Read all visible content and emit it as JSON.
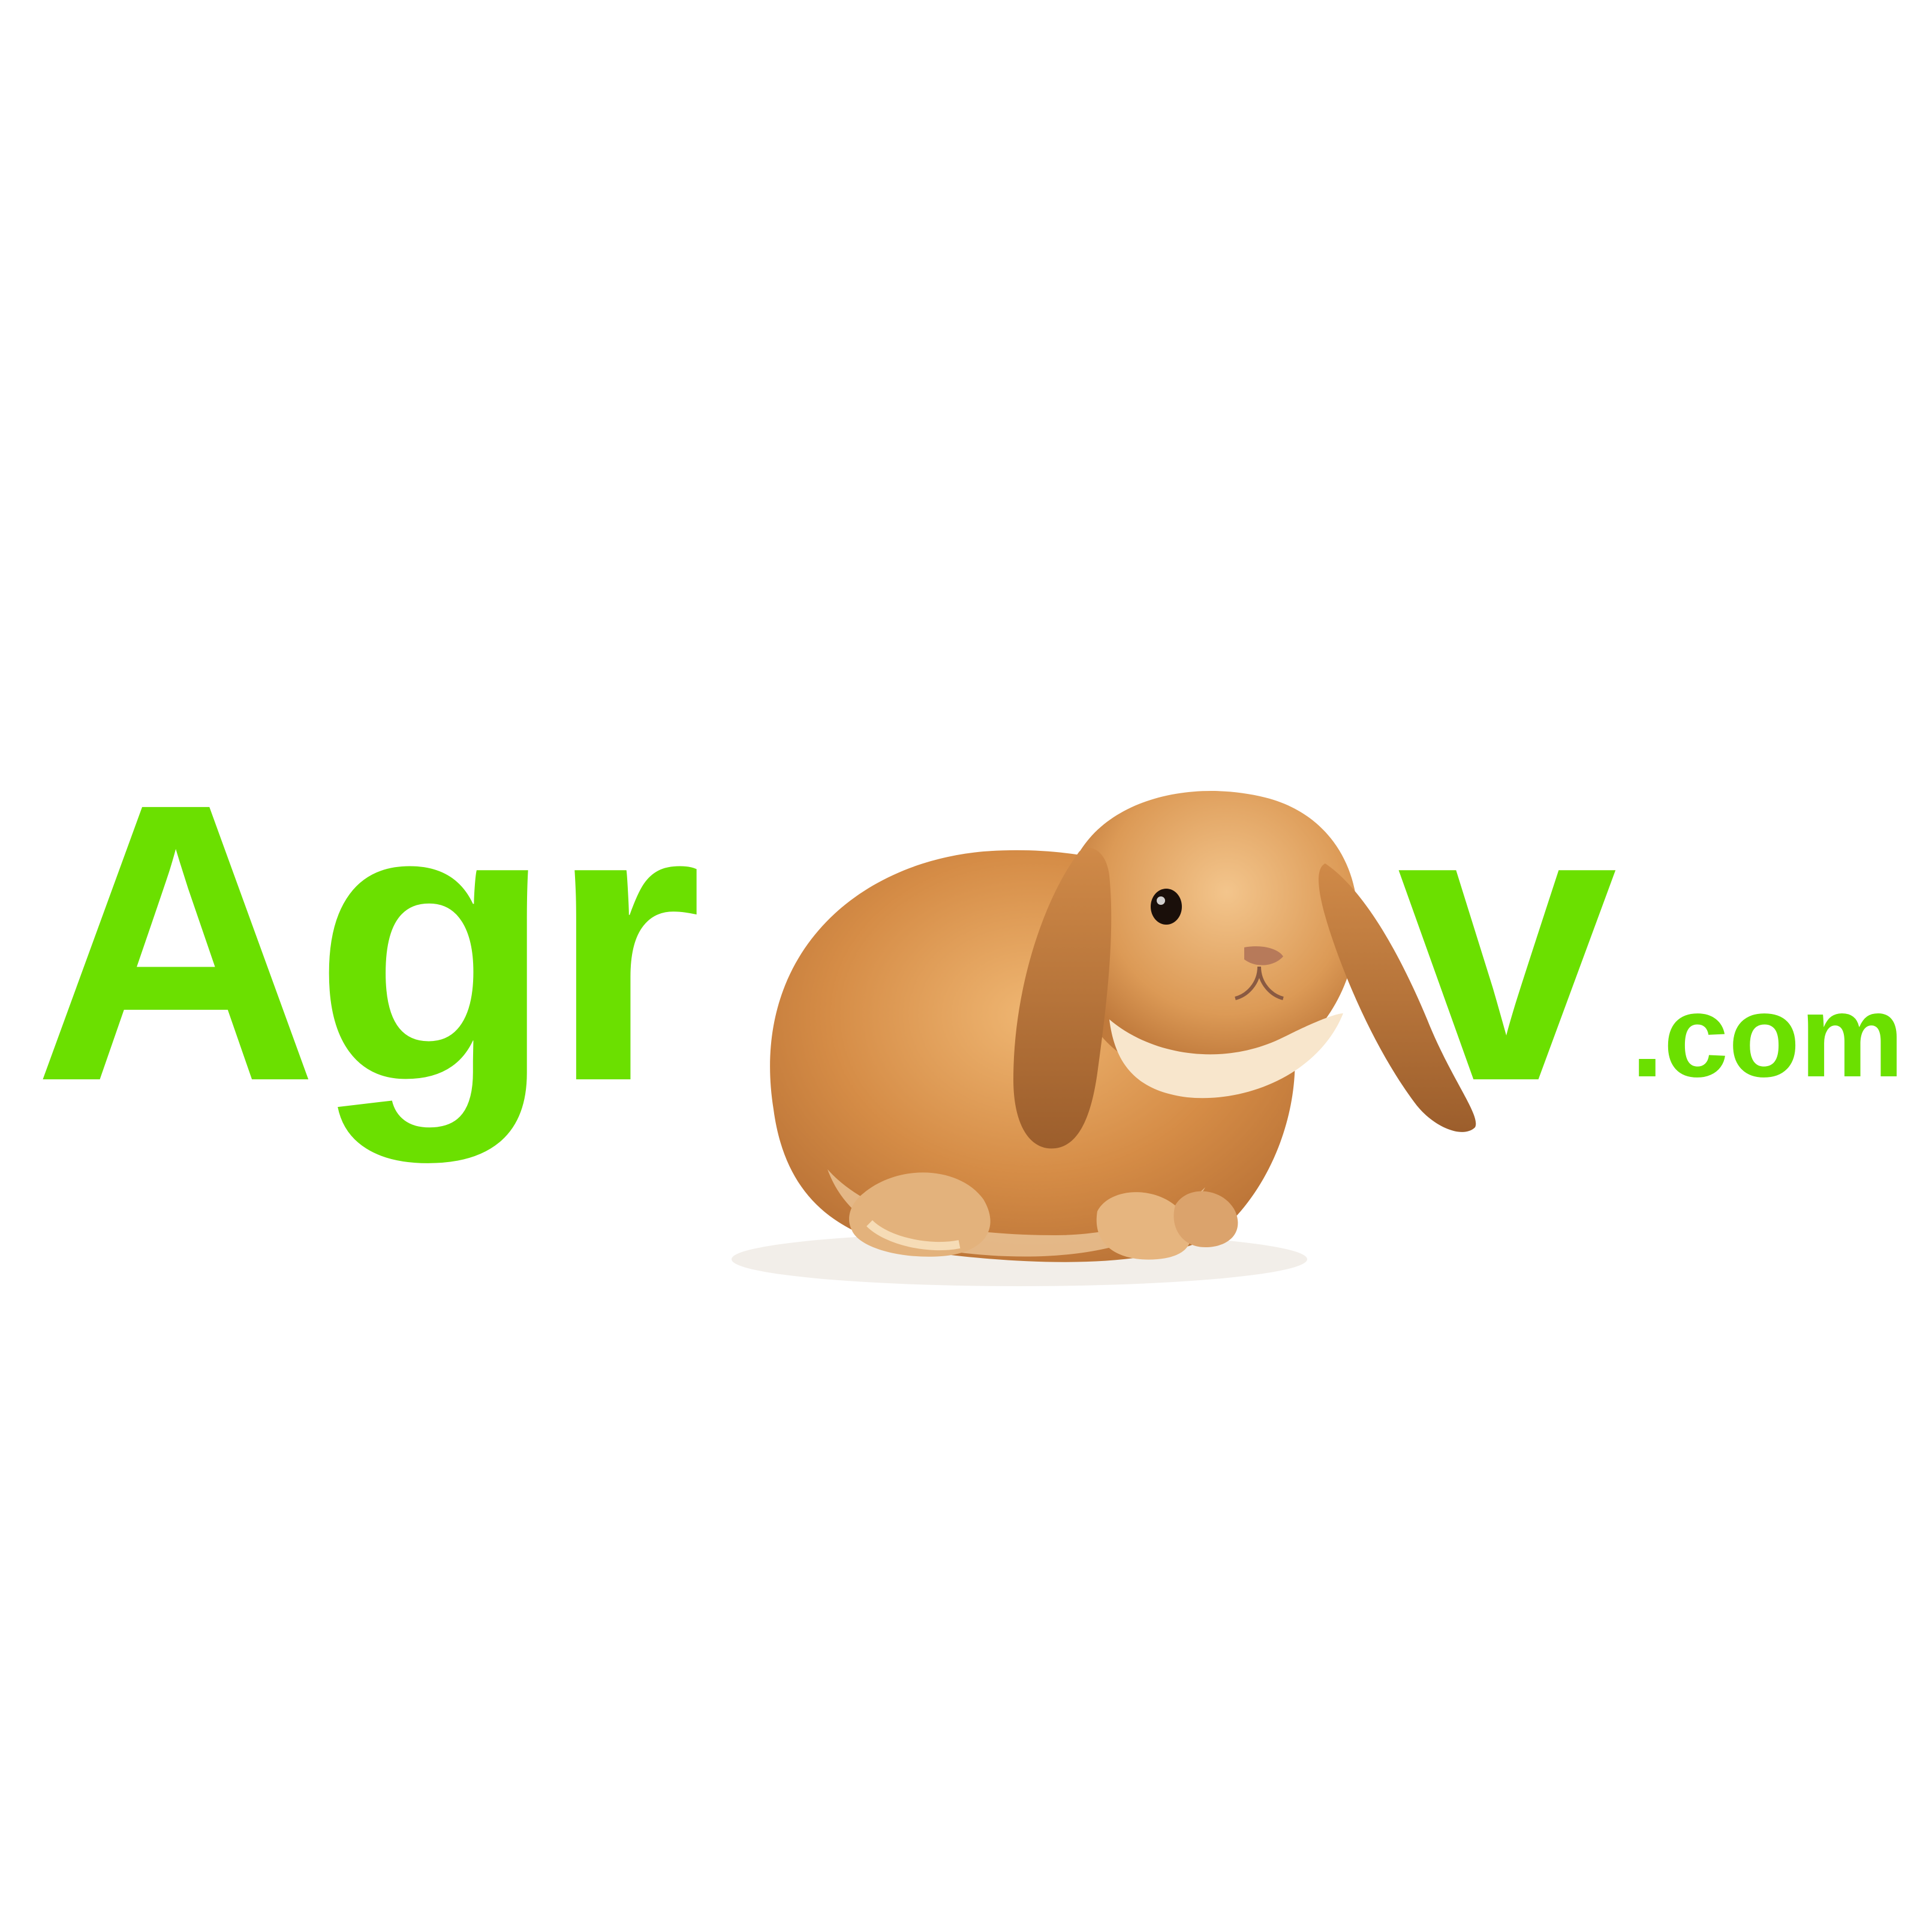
{
  "logo": {
    "text_left": "Agr",
    "text_right": "v",
    "suffix": ".com",
    "text_color": "#6be000",
    "background": "#ffffff",
    "mascot": "lop-eared-rabbit",
    "mascot_colors": {
      "fur": "#d8924a",
      "fur_light": "#efc08a",
      "fur_dark": "#a86a36",
      "ear": "#b7713a",
      "chest": "#f8e6cc",
      "eye": "#1a0f0a"
    }
  }
}
